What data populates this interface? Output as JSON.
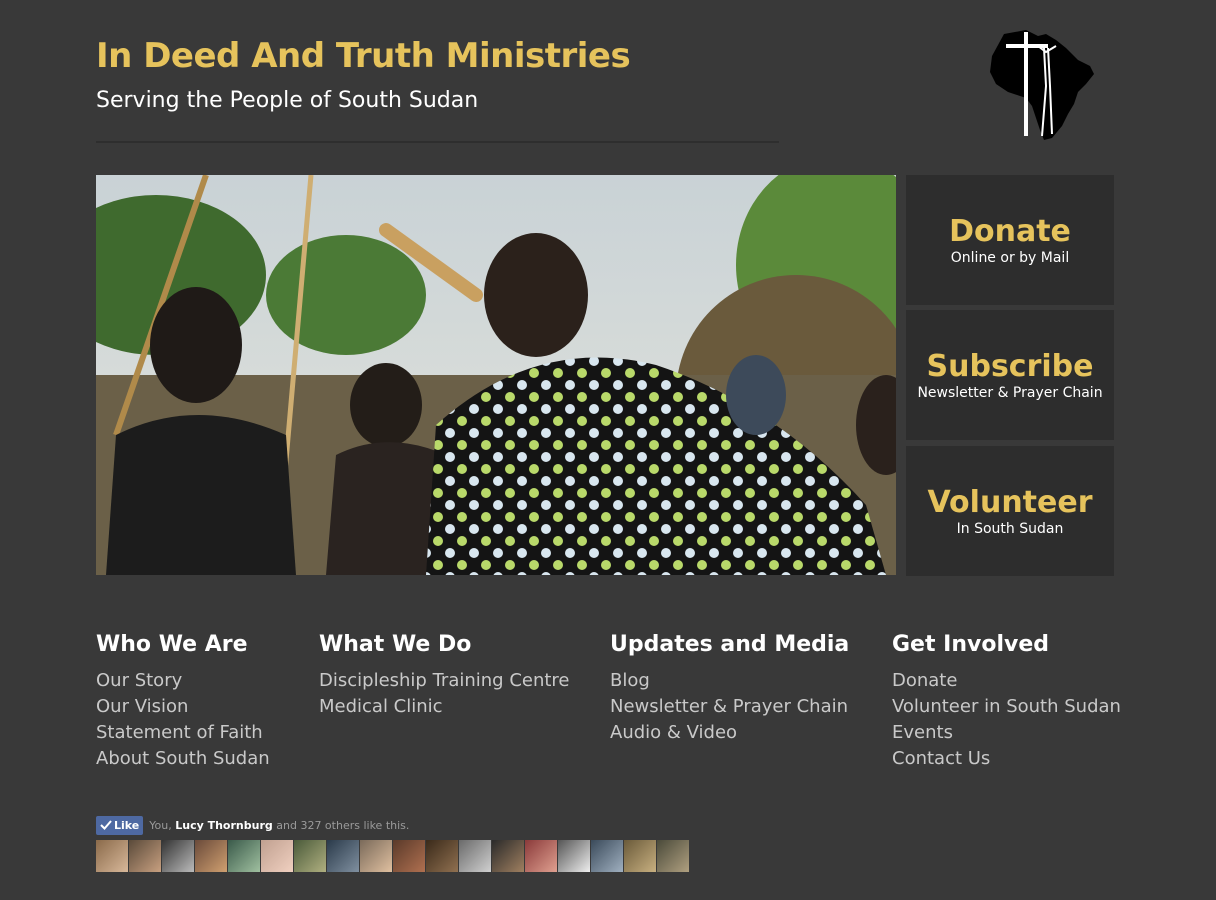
{
  "header": {
    "title": "In Deed And Truth Ministries",
    "tagline": "Serving the People of South Sudan",
    "logo_icon": "africa-cross-logo-icon"
  },
  "hero": {
    "image_icon": "hero-photo-dancers"
  },
  "cta": [
    {
      "title": "Donate",
      "subtitle": "Online or by Mail"
    },
    {
      "title": "Subscribe",
      "subtitle": "Newsletter & Prayer Chain"
    },
    {
      "title": "Volunteer",
      "subtitle": "In South Sudan"
    }
  ],
  "footer": {
    "who": {
      "heading": "Who We Are",
      "links": [
        "Our Story",
        "Our Vision",
        "Statement of Faith",
        "About South Sudan"
      ]
    },
    "what": {
      "heading": "What We Do",
      "links": [
        "Discipleship Training Centre",
        "Medical Clinic"
      ]
    },
    "updates": {
      "heading": "Updates and Media",
      "links": [
        "Blog",
        "Newsletter & Prayer Chain",
        "Audio & Video"
      ]
    },
    "involved": {
      "heading": "Get Involved",
      "links": [
        "Donate",
        "Volunteer in South Sudan",
        "Events",
        "Contact Us"
      ]
    }
  },
  "facebook": {
    "like_label": "Like",
    "text_prefix": "You,",
    "friend_name": "Lucy Thornburg",
    "text_suffix": "and 327 others like this."
  },
  "colors": {
    "background": "#393939",
    "accent": "#e6c35c",
    "panel": "#2d2d2d"
  }
}
